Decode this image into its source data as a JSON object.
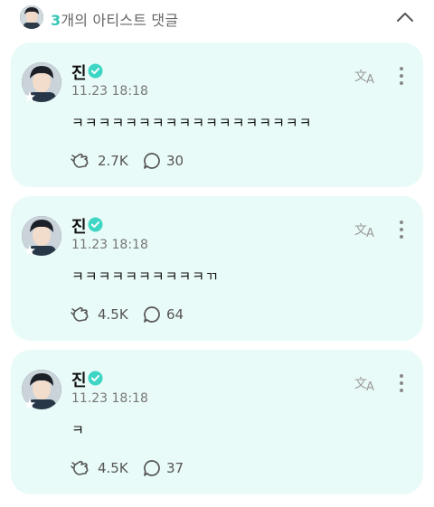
{
  "header": {
    "count": "3",
    "title_rest": "개의 아티스트 댓글"
  },
  "comments": [
    {
      "name": "진",
      "date": "11.23 18:18",
      "text": "ㅋㅋㅋㅋㅋㅋㅋㅋㅋㅋㅋㅋㅋㅋㅋㅋㅋㅋ",
      "cheers": "2.7K",
      "replies": "30"
    },
    {
      "name": "진",
      "date": "11.23 18:18",
      "text": "ㅋㅋㅋㅋㅋㅋㅋㅋㅋㅋㄲ",
      "cheers": "4.5K",
      "replies": "64"
    },
    {
      "name": "진",
      "date": "11.23 18:18",
      "text": "ㅋ",
      "cheers": "4.5K",
      "replies": "37"
    }
  ],
  "icons": {
    "verified": "verified-badge-icon",
    "translate": "translate-icon",
    "more": "more-vertical-icon",
    "cheer": "cheer-hand-icon",
    "reply": "reply-bubble-icon",
    "collapse": "chevron-up-icon"
  },
  "colors": {
    "accent": "#37c6b6",
    "card_bg": "#e9fbf8",
    "verified": "#3dd6c5"
  }
}
